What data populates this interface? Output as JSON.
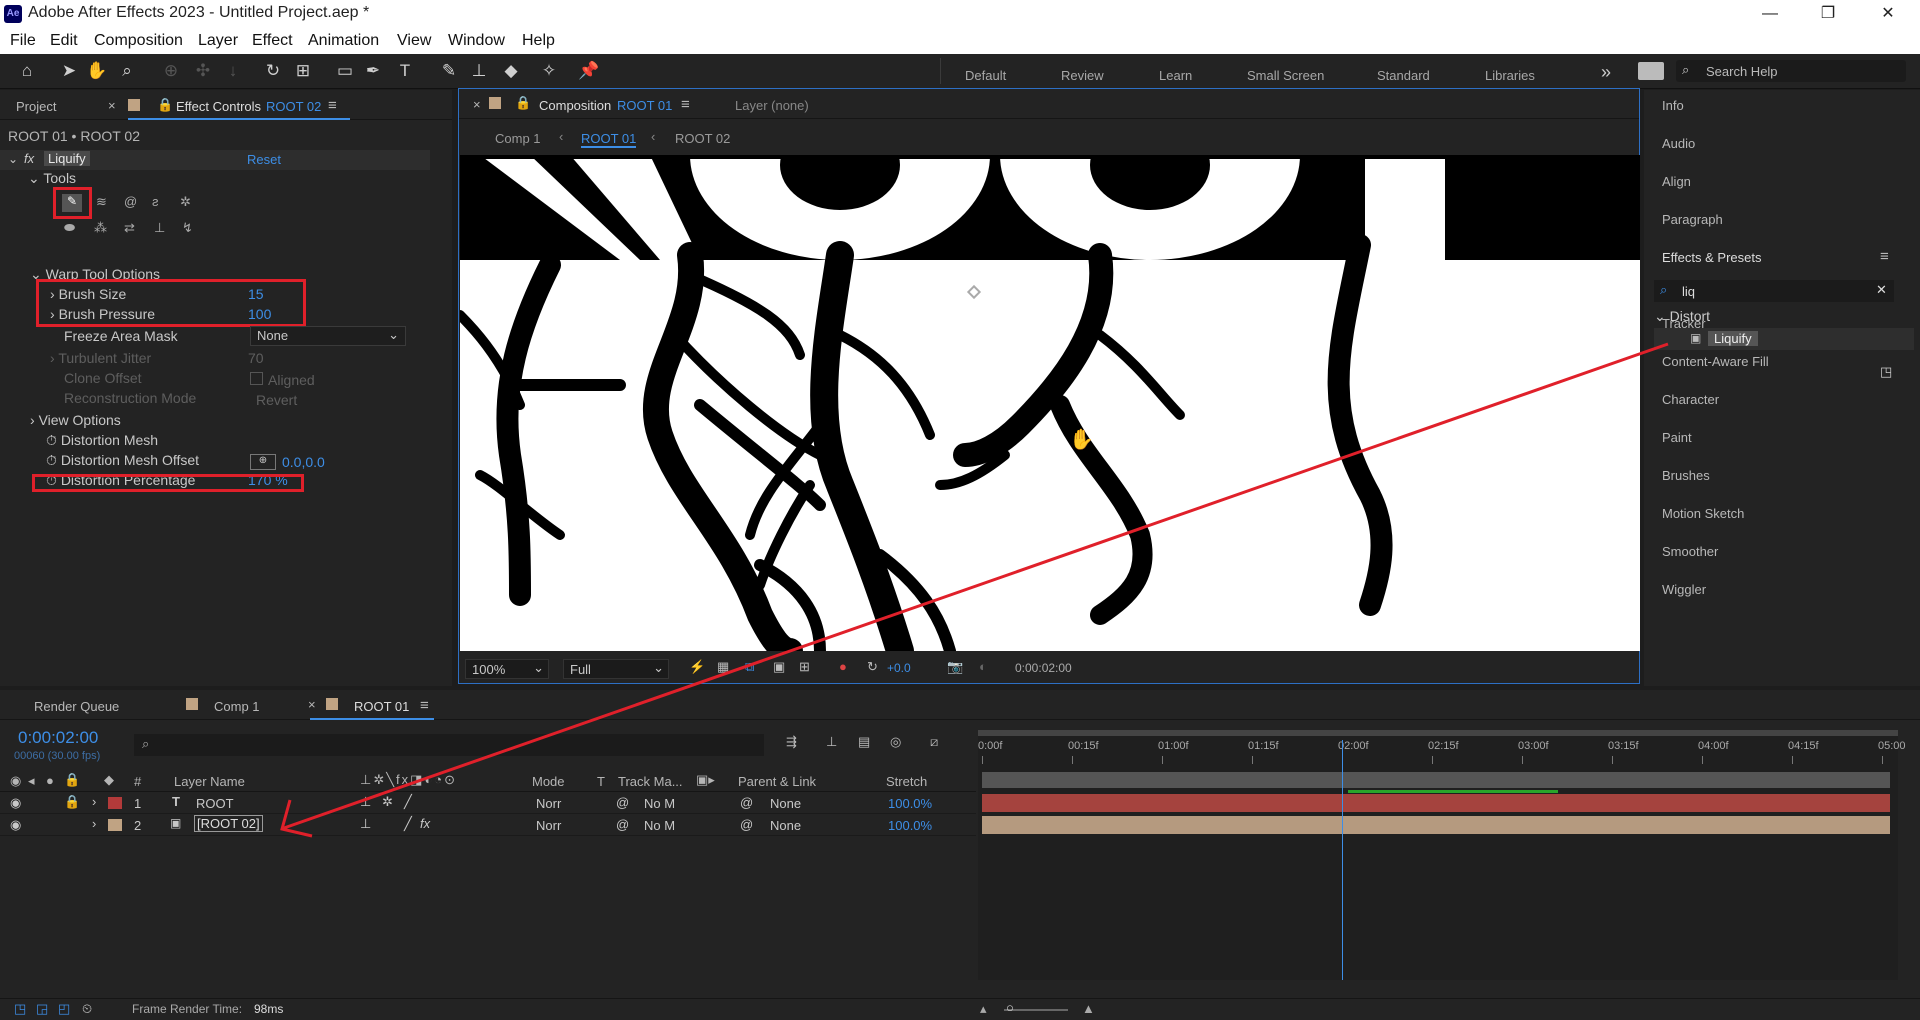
{
  "window": {
    "title": "Adobe After Effects 2023 - Untitled Project.aep *",
    "app_badge": "Ae",
    "minimize": "—",
    "restore": "❐",
    "close": "✕"
  },
  "menu": [
    "File",
    "Edit",
    "Composition",
    "Layer",
    "Effect",
    "Animation",
    "View",
    "Window",
    "Help"
  ],
  "workspaces": [
    "Default",
    "Review",
    "Learn",
    "Small Screen",
    "Standard",
    "Libraries"
  ],
  "workspace_more": "»",
  "search_help": "Search Help",
  "left_panel": {
    "tab_project": "Project",
    "tab_effect_controls": "Effect Controls",
    "tab_layer": "ROOT 02",
    "breadcrumb": "ROOT 01 • ROOT 02",
    "effect_name": "Liquify",
    "reset": "Reset",
    "tools_label": "Tools",
    "warp_label": "Warp Tool Options",
    "brush_size_label": "Brush Size",
    "brush_size_value": "15",
    "brush_pressure_label": "Brush Pressure",
    "brush_pressure_value": "100",
    "freeze_label": "Freeze Area Mask",
    "freeze_value": "None",
    "turbulent_label": "Turbulent Jitter",
    "turbulent_value": "70",
    "clone_label": "Clone Offset",
    "aligned_label": "Aligned",
    "recon_label": "Reconstruction Mode",
    "recon_value": "Revert",
    "view_options": "View Options",
    "mesh_label": "Distortion Mesh",
    "mesh_offset_label": "Distortion Mesh Offset",
    "mesh_offset_value": "0.0,0.0",
    "percent_label": "Distortion Percentage",
    "percent_value": "170 %"
  },
  "comp_panel": {
    "tab_composition": "Composition",
    "tab_comp_name": "ROOT 01",
    "tab_layer": "Layer (none)",
    "crumbs": [
      "Comp 1",
      "ROOT 01",
      "ROOT 02"
    ],
    "zoom": "100%",
    "resolution": "Full",
    "exposure": "+0.0",
    "timecode": "0:00:02:00"
  },
  "right_panel": {
    "items_top": [
      "Info",
      "Audio",
      "Align",
      "Paragraph"
    ],
    "effects_title": "Effects & Presets",
    "search_value": "liq",
    "category": "Distort",
    "result": "Liquify",
    "items_bottom": [
      "Tracker",
      "Content-Aware Fill",
      "Character",
      "Paint",
      "Brushes",
      "Motion Sketch",
      "Smoother",
      "Wiggler"
    ]
  },
  "timeline": {
    "tab_render": "Render Queue",
    "tab_comp1": "Comp 1",
    "tab_root01": "ROOT 01",
    "timecode": "0:00:02:00",
    "frames": "00060 (30.00 fps)",
    "headers": {
      "layer_name": "Layer Name",
      "mode": "Mode",
      "t": "T",
      "track_matte": "Track Ma...",
      "parent": "Parent & Link",
      "stretch": "Stretch",
      "num": "#"
    },
    "ruler": [
      "0:00f",
      "00:15f",
      "01:00f",
      "01:15f",
      "02:00f",
      "02:15f",
      "03:00f",
      "03:15f",
      "04:00f",
      "04:15f",
      "05:00"
    ],
    "playhead_time": 2.0,
    "duration": 5.0,
    "layers": [
      {
        "num": "1",
        "type": "T",
        "name": "ROOT",
        "mode": "Norr",
        "track": "No M",
        "parent": "None",
        "stretch": "100.0%",
        "color": "#b33a3a",
        "bar": "#a5433e"
      },
      {
        "num": "2",
        "type": "img",
        "name": "[ROOT 02]",
        "mode": "Norr",
        "track": "No M",
        "parent": "None",
        "stretch": "100.0%",
        "color": "#c0a383",
        "bar": "#b59a7f"
      }
    ],
    "render_time_label": "Frame Render Time:",
    "render_time_value": "98ms"
  },
  "colors": {
    "accent": "#3d8ee6",
    "highlight": "#e0202a"
  }
}
